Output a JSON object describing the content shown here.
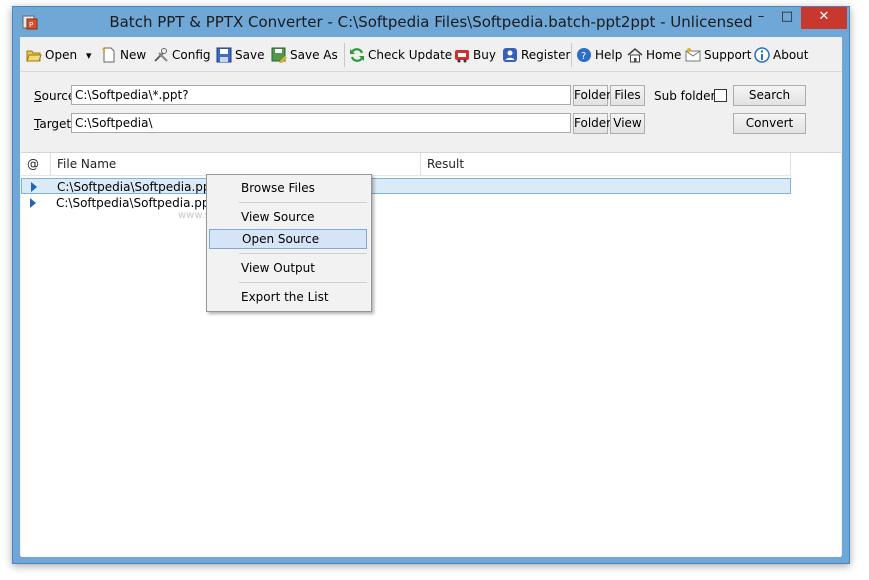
{
  "window": {
    "title": "Batch PPT & PPTX Converter - C:\\Softpedia Files\\Softpedia.batch-ppt2ppt - Unlicensed",
    "min_glyph": "–",
    "max_glyph": "□",
    "close_glyph": "✕"
  },
  "toolbar": {
    "open": "Open",
    "dropdown_glyph": "▾",
    "new": "New",
    "config": "Config",
    "save": "Save",
    "save_as": "Save As",
    "check_update": "Check Update",
    "buy": "Buy",
    "register": "Register",
    "help": "Help",
    "home": "Home",
    "support": "Support",
    "about": "About"
  },
  "form": {
    "source_label_u": "S",
    "source_label_rest": "ource",
    "source_value": "C:\\Softpedia\\*.ppt?",
    "target_label_u": "T",
    "target_label_rest": "arget",
    "target_value": "C:\\Softpedia\\",
    "folder_button": "Folder",
    "files_button": "Files",
    "view_button": "View",
    "subfolders_label": "Sub folders",
    "subfolders_checked": false,
    "search_button": "Search",
    "convert_button": "Convert"
  },
  "list": {
    "columns": [
      "@",
      "File Name",
      "Result"
    ],
    "rows": [
      {
        "file": "C:\\Softpedia\\Softpedia.ppt",
        "result": ""
      },
      {
        "file": "C:\\Softpedia\\Softpedia.pptx",
        "result": ""
      }
    ]
  },
  "context_menu": {
    "items": [
      "Browse Files",
      "View  Source",
      "Open Source",
      "View  Output",
      "Export the List"
    ],
    "highlighted": "Open Source"
  },
  "watermark": "www.softpedia.com",
  "colors": {
    "frame": "#6fa8d6",
    "close": "#c7392f",
    "selection": "#dbeaf7",
    "menu_highlight": "#d5e4f6"
  }
}
